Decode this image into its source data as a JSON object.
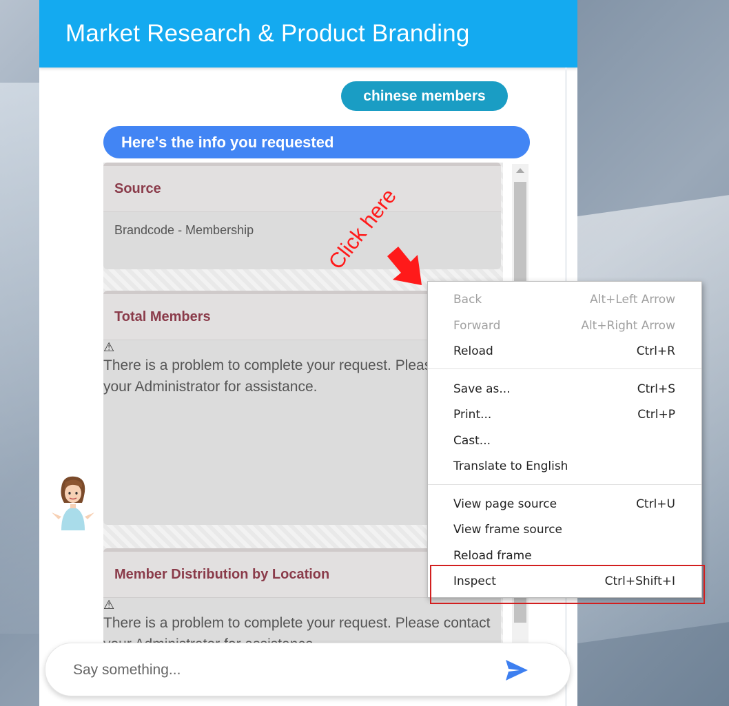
{
  "header": {
    "title": "Market Research & Product Branding"
  },
  "conversation": {
    "user_message": "chinese members",
    "bot_message": "Here's the info you requested"
  },
  "cards": [
    {
      "title": "Source",
      "body": "Brandcode - Membership"
    },
    {
      "title": "Total Members",
      "warning_icon": "⚠",
      "body": "There is a problem to complete your request. Please contact your Administrator for assistance."
    },
    {
      "title": "Member Distribution by Location",
      "warning_icon": "⚠",
      "body": "There is a problem to complete your request. Please contact your Administrator for assistance."
    }
  ],
  "input": {
    "placeholder": "Say something..."
  },
  "annotation": {
    "label": "Click here",
    "color": "#ff1a1a"
  },
  "context_menu": {
    "items": [
      {
        "label": "Back",
        "shortcut": "Alt+Left Arrow",
        "disabled": true
      },
      {
        "label": "Forward",
        "shortcut": "Alt+Right Arrow",
        "disabled": true
      },
      {
        "label": "Reload",
        "shortcut": "Ctrl+R"
      },
      {
        "label": "Save as...",
        "shortcut": "Ctrl+S"
      },
      {
        "label": "Print...",
        "shortcut": "Ctrl+P"
      },
      {
        "label": "Cast...",
        "shortcut": ""
      },
      {
        "label": "Translate to English",
        "shortcut": ""
      },
      {
        "label": "View page source",
        "shortcut": "Ctrl+U"
      },
      {
        "label": "View frame source",
        "shortcut": ""
      },
      {
        "label": "Reload frame",
        "shortcut": ""
      },
      {
        "label": "Inspect",
        "shortcut": "Ctrl+Shift+I",
        "highlighted": true
      }
    ]
  },
  "colors": {
    "header": "#14aaf0",
    "user_chip": "#1a9dc4",
    "bot_bubble": "#4285f4",
    "card_title": "#8a3b4a",
    "send_icon": "#3d7ff0",
    "highlight": "#d21f1f"
  }
}
